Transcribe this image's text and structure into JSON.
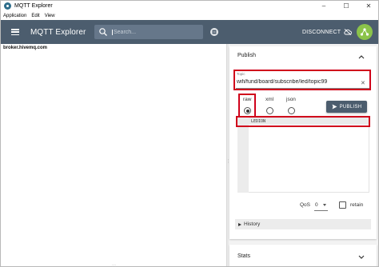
{
  "window": {
    "title": "MQTT Explorer",
    "minimize": "–",
    "maximize": "☐",
    "close": "✕"
  },
  "menu": [
    "Application",
    "Edit",
    "View"
  ],
  "appbar": {
    "title": "MQTT Explorer",
    "search_placeholder": "Search...",
    "disconnect_label": "DISCONNECT"
  },
  "tree": {
    "broker": "broker.hivemq.com"
  },
  "publish": {
    "header": "Publish",
    "topic_label": "Topic",
    "topic_value": "wifi/fund/board/subscribe/led/topic99",
    "formats": [
      {
        "label": "raw",
        "checked": true
      },
      {
        "label": "xml",
        "checked": false
      },
      {
        "label": "json",
        "checked": false
      }
    ],
    "publish_button": "PUBLISH",
    "payload": "LEDION",
    "qos_label": "QoS",
    "qos_value": "0",
    "retain_label": "retain",
    "retain_checked": false,
    "history_label": "History"
  },
  "stats": {
    "header": "Stats"
  },
  "colors": {
    "appbar": "#4c5d6e",
    "highlight": "#d0021b",
    "avatar": "#8bc34a"
  }
}
